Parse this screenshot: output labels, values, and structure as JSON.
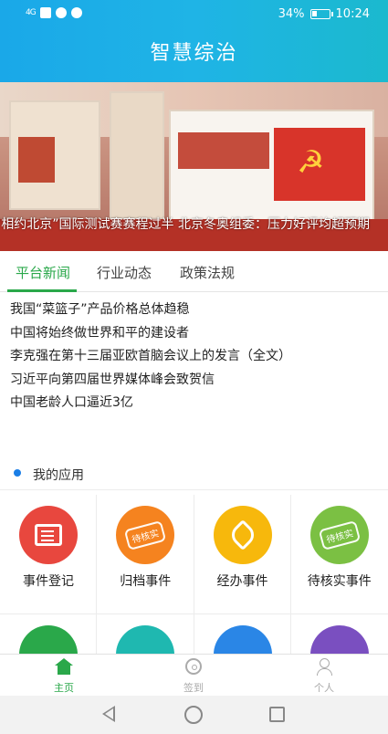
{
  "status_bar": {
    "signal": "4G",
    "battery": "34%",
    "battery_level": 0.34,
    "time": "10:24"
  },
  "header": {
    "title": "智慧综治"
  },
  "banner": {
    "ticker": "“相约北京”国际测试赛赛程过半 北京冬奥组委：压力好评均超预期"
  },
  "tabs": [
    {
      "label": "平台新闻",
      "active": true
    },
    {
      "label": "行业动态",
      "active": false
    },
    {
      "label": "政策法规",
      "active": false
    }
  ],
  "news": [
    "我国“菜篮子”产品价格总体趋稳",
    "中国将始终做世界和平的建设者",
    "李克强在第十三届亚欧首脑会议上的发言（全文）",
    "习近平向第四届世界媒体峰会致贺信",
    "中国老龄人口逼近3亿"
  ],
  "apps": {
    "title": "我的应用",
    "items": [
      {
        "label": "事件登记",
        "icon": "form-edit-icon",
        "color": "#e8473e"
      },
      {
        "label": "归档事件",
        "icon": "archive-stamp-icon",
        "color": "#f5831f",
        "stamp": "待核实"
      },
      {
        "label": "经办事件",
        "icon": "pen-icon",
        "color": "#f7b80c"
      },
      {
        "label": "待核实事件",
        "icon": "verify-stamp-icon",
        "color": "#7bc043",
        "stamp": "待核实"
      },
      {
        "label": "",
        "icon": "app-icon-5",
        "color": "#2aa84a"
      },
      {
        "label": "",
        "icon": "app-icon-6",
        "color": "#1fb8b0"
      },
      {
        "label": "",
        "icon": "calendar-icon",
        "color": "#2a86e6"
      },
      {
        "label": "",
        "icon": "app-icon-8",
        "color": "#7a4fc0"
      }
    ]
  },
  "bottom_nav": {
    "home": "主页",
    "signin": "签到",
    "profile": "个人"
  },
  "colors": {
    "accent": "#2aa84a",
    "header_start": "#1aa8e8",
    "header_end": "#1bb9ce"
  }
}
